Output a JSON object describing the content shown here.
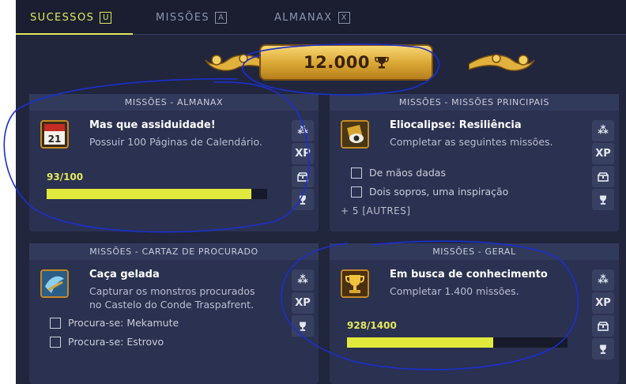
{
  "tabs": [
    {
      "label": "SUCESSOS",
      "key": "U"
    },
    {
      "label": "MISSÕES",
      "key": "A"
    },
    {
      "label": "ALMANAX",
      "key": "X"
    }
  ],
  "score": {
    "value": "12.000"
  },
  "cards": [
    {
      "header": "MISSÕES - ALMANAX",
      "title": "Mas que assiduidade!",
      "description": "Possuir 100 Páginas de Calendário.",
      "icon": "calendar-icon",
      "progress_label": "93/100",
      "progress": 0.93
    },
    {
      "header": "MISSÕES - MISSÕES PRINCIPAIS",
      "title": "Eliocalipse: Resiliência",
      "description": "Completar as seguintes missões.",
      "icon": "eye-scroll-icon",
      "objectives": [
        "De mãos dadas",
        "Dois sopros, uma inspiração"
      ],
      "more": "+ 5 [AUTRES]"
    },
    {
      "header": "MISSÕES - CARTAZ DE PROCURADO",
      "title": "Caça gelada",
      "description_line1": "Capturar os monstros procurados",
      "description_line2": "no Castelo do Conde Traspafrent.",
      "icon": "ice-hunter-icon",
      "objectives": [
        "Procura-se: Mekamute",
        "Procura-se: Estrovo"
      ]
    },
    {
      "header": "MISSÕES - GERAL",
      "title": "Em busca de conhecimento",
      "description": "Completar 1.400 missões.",
      "icon": "golden-trophy-icon",
      "progress_label": "928/1400",
      "progress": 0.663
    }
  ],
  "side_icons": {
    "xp": "XP",
    "kamas": "⁂"
  },
  "colors": {
    "accent": "#dfe85a",
    "background": "#21263d",
    "card": "#2b3150",
    "progress": "#e1ea3c",
    "annotation": "#1a2fd0"
  }
}
